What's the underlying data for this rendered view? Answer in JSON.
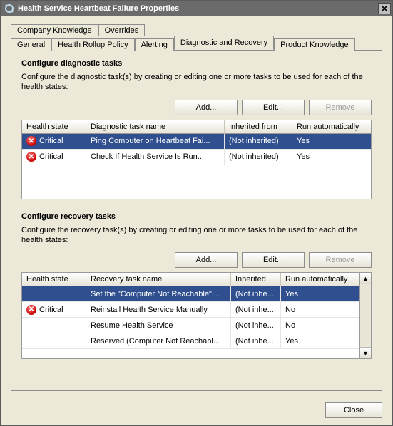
{
  "titlebar": {
    "title": "Health Service Heartbeat Failure Properties"
  },
  "tabs_row1": [
    "Company Knowledge",
    "Overrides"
  ],
  "tabs_row2": [
    "General",
    "Health Rollup Policy",
    "Alerting",
    "Diagnostic and Recovery",
    "Product Knowledge"
  ],
  "active_tab": "Diagnostic and Recovery",
  "diagnostic": {
    "title": "Configure diagnostic tasks",
    "desc": "Configure the diagnostic task(s) by creating or editing one or more tasks to be used for each of the health states:",
    "buttons": {
      "add": "Add...",
      "edit": "Edit...",
      "remove": "Remove"
    },
    "columns": [
      "Health state",
      "Diagnostic task name",
      "Inherited from",
      "Run automatically"
    ],
    "rows": [
      {
        "state": "Critical",
        "name": "Ping Computer on Heartbeat Fai...",
        "inherited": "(Not inherited)",
        "auto": "Yes",
        "selected": true,
        "icon": true
      },
      {
        "state": "Critical",
        "name": "Check If Health Service Is Run...",
        "inherited": "(Not inherited)",
        "auto": "Yes",
        "selected": false,
        "icon": true
      }
    ]
  },
  "recovery": {
    "title": "Configure recovery tasks",
    "desc": "Configure the recovery task(s) by creating or editing one or more tasks to be used for each of the health states:",
    "buttons": {
      "add": "Add...",
      "edit": "Edit...",
      "remove": "Remove"
    },
    "columns": [
      "Health state",
      "Recovery task name",
      "Inherited",
      "Run automatically"
    ],
    "rows": [
      {
        "state": "",
        "name": "Set the \"Computer Not Reachable\"...",
        "inherited": "(Not inhe...",
        "auto": "Yes",
        "selected": true,
        "icon": false
      },
      {
        "state": "Critical",
        "name": "Reinstall Health Service Manually",
        "inherited": "(Not inhe...",
        "auto": "No",
        "selected": false,
        "icon": true
      },
      {
        "state": "",
        "name": "Resume Health Service",
        "inherited": "(Not inhe...",
        "auto": "No",
        "selected": false,
        "icon": false
      },
      {
        "state": "",
        "name": "Reserved (Computer Not Reachabl...",
        "inherited": "(Not inhe...",
        "auto": "Yes",
        "selected": false,
        "icon": false
      }
    ]
  },
  "footer": {
    "close": "Close"
  }
}
